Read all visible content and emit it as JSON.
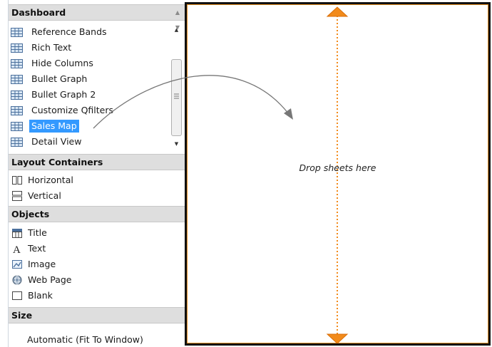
{
  "dashboard_section": {
    "title": "Dashboard",
    "sheets": [
      {
        "label": "Reference Bands",
        "selected": false
      },
      {
        "label": "Rich Text",
        "selected": false
      },
      {
        "label": "Hide Columns",
        "selected": false
      },
      {
        "label": "Bullet Graph",
        "selected": false
      },
      {
        "label": "Bullet Graph 2",
        "selected": false
      },
      {
        "label": "Customize Qfilters",
        "selected": false
      },
      {
        "label": "Sales Map",
        "selected": true
      },
      {
        "label": "Detail View",
        "selected": false
      }
    ]
  },
  "layout_containers": {
    "title": "Layout Containers",
    "items": [
      {
        "label": "Horizontal",
        "icon": "horizontal-container-icon"
      },
      {
        "label": "Vertical",
        "icon": "vertical-container-icon"
      }
    ]
  },
  "objects": {
    "title": "Objects",
    "items": [
      {
        "label": "Title",
        "icon": "title-object-icon"
      },
      {
        "label": "Text",
        "icon": "text-object-icon"
      },
      {
        "label": "Image",
        "icon": "image-object-icon"
      },
      {
        "label": "Web Page",
        "icon": "web-page-icon"
      },
      {
        "label": "Blank",
        "icon": "blank-object-icon"
      }
    ]
  },
  "size": {
    "title": "Size",
    "value": "Automatic (Fit To Window)"
  },
  "canvas": {
    "drop_text": "Drop sheets here"
  },
  "colors": {
    "selection": "#3399ff",
    "resize_handle": "#f28a1a",
    "header_bg": "#dedede"
  }
}
